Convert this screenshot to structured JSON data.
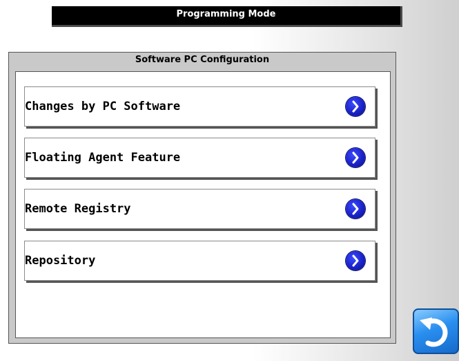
{
  "header": {
    "title": "Programming Mode"
  },
  "panel": {
    "title": "Software PC Configuration",
    "items": [
      {
        "label": "Changes by PC Software",
        "icon": "chevron-right-icon"
      },
      {
        "label": "Floating Agent Feature",
        "icon": "chevron-right-icon"
      },
      {
        "label": "Remote Registry",
        "icon": "chevron-right-icon"
      },
      {
        "label": "Repository",
        "icon": "chevron-right-icon"
      }
    ]
  },
  "back_button": {
    "icon": "back-arrow-icon"
  },
  "colors": {
    "header_bg": "#000000",
    "panel_bg": "#c9c9c9",
    "chevron_blue": "#1a22c8",
    "back_button_blue": "#2a8ff0"
  }
}
